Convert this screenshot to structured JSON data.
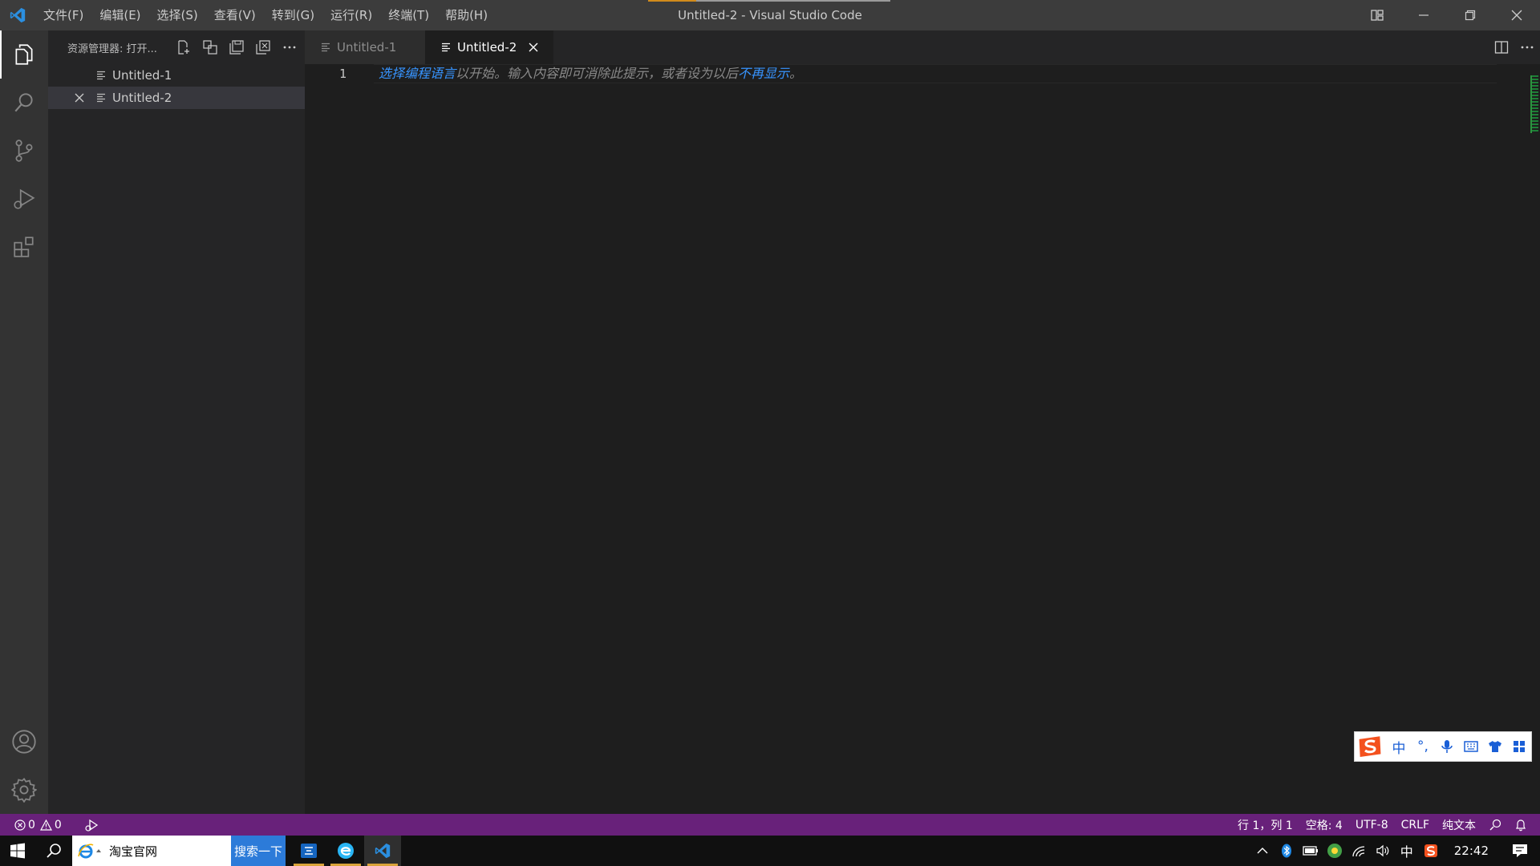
{
  "window": {
    "title": "Untitled-2 - Visual Studio Code"
  },
  "menu": {
    "items": [
      "文件(F)",
      "编辑(E)",
      "选择(S)",
      "查看(V)",
      "转到(G)",
      "运行(R)",
      "终端(T)",
      "帮助(H)"
    ]
  },
  "sidebar": {
    "title": "资源管理器: 打开...",
    "open_editors": [
      {
        "label": "Untitled-1"
      },
      {
        "label": "Untitled-2"
      }
    ]
  },
  "tabs": [
    {
      "label": "Untitled-1"
    },
    {
      "label": "Untitled-2"
    }
  ],
  "editor": {
    "line_number": "1",
    "hint_link1": "选择编程语言",
    "hint_middle": "以开始。输入内容即可消除此提示，或者设为以后",
    "hint_link2": "不再显示",
    "hint_end": "。"
  },
  "ime": {
    "mode": "中",
    "punct": "°,"
  },
  "statusbar": {
    "errors": "0",
    "warnings": "0",
    "position": "行 1，列 1",
    "indent": "空格: 4",
    "encoding": "UTF-8",
    "eol": "CRLF",
    "language": "纯文本"
  },
  "taskbar": {
    "address_text": "淘宝官网",
    "search_button": "搜索一下",
    "ime_indicator": "中",
    "clock": "22:42"
  },
  "colors": {
    "statusbar": "#68217a",
    "accent_link": "#3794ff"
  }
}
